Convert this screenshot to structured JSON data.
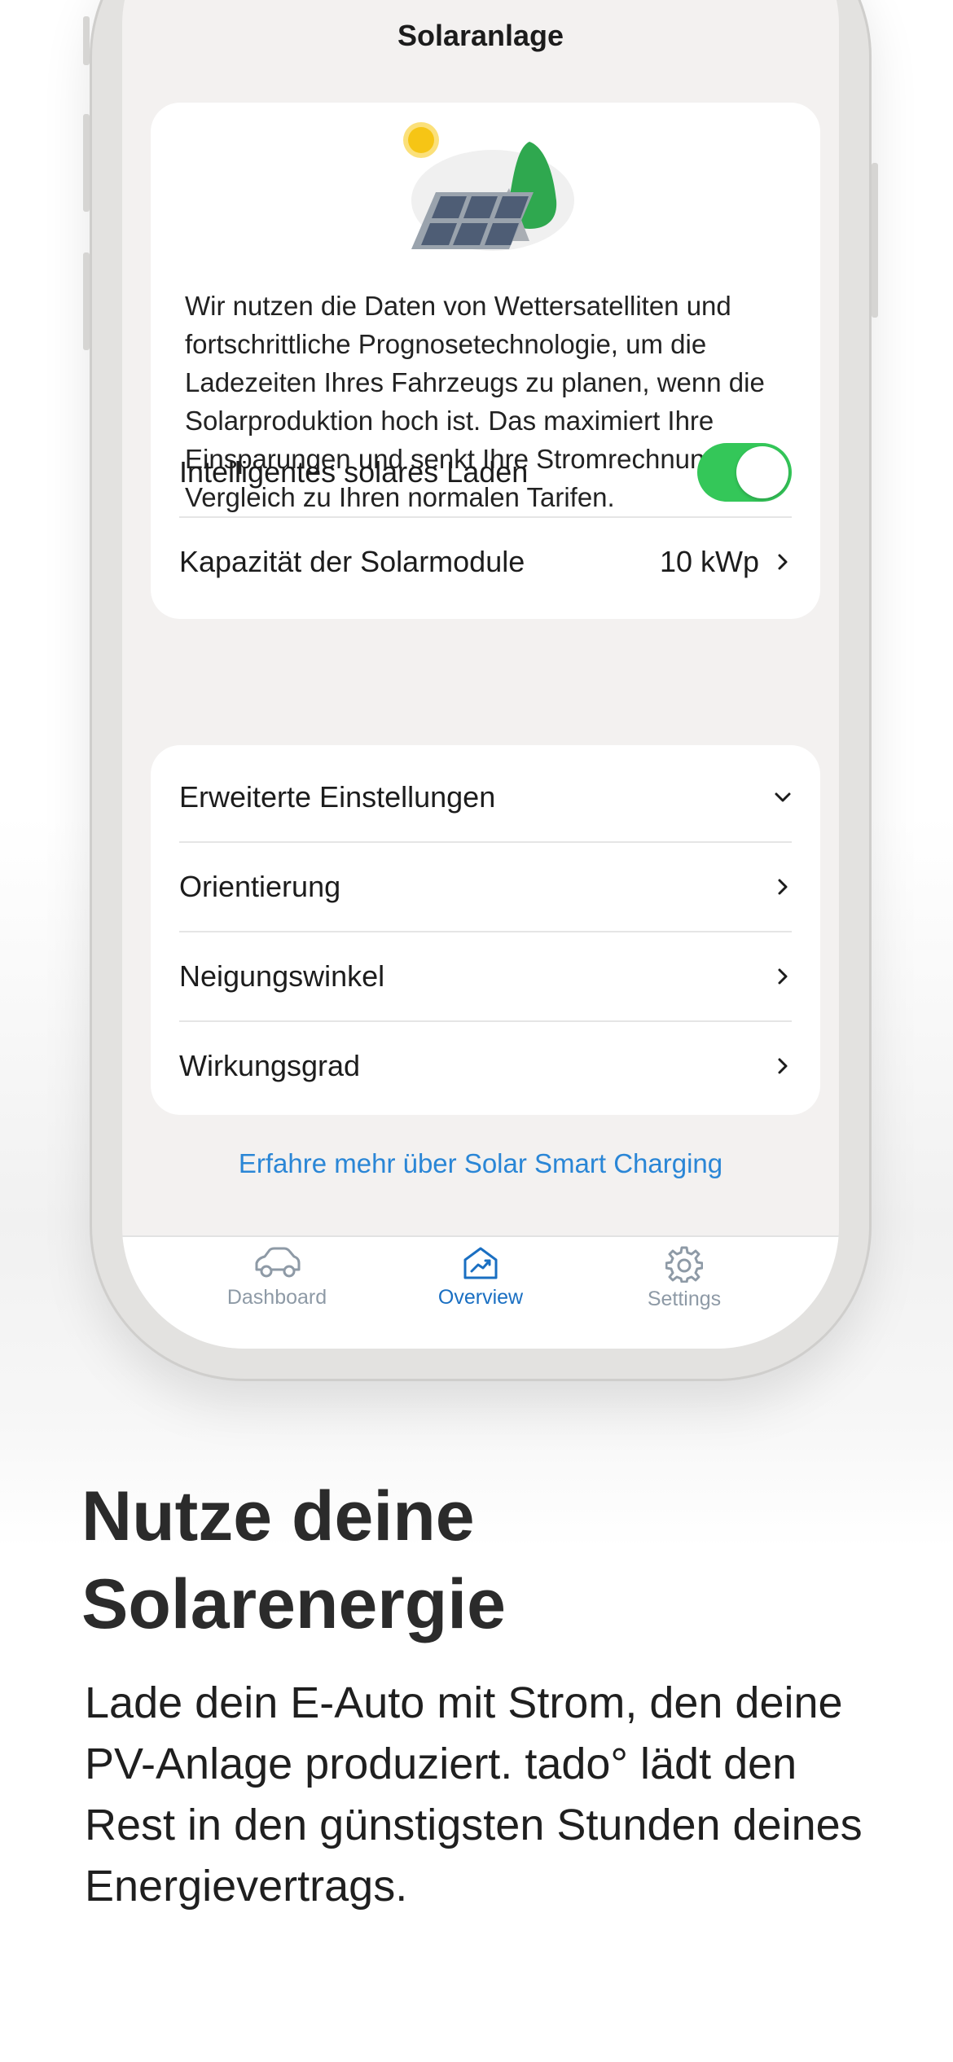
{
  "screen": {
    "title": "Solaranlage",
    "description": "Wir nutzen die Daten von Wettersatelliten und fortschrittliche Prognosetechnologie, um die Ladezeiten Ihres Fahrzeugs zu planen, wenn die Solarproduktion hoch ist. Das maximiert Ihre Einsparungen und senkt Ihre Stromrechnung im Vergleich zu Ihren normalen Tarifen.",
    "smart_charging": {
      "label": "Intelligentes solares Laden",
      "enabled": true
    },
    "capacity": {
      "label": "Kapazität der Solarmodule",
      "value": "10 kWp"
    },
    "advanced": {
      "header": "Erweiterte Einstellungen",
      "items": [
        {
          "label": "Orientierung"
        },
        {
          "label": "Neigungswinkel"
        },
        {
          "label": "Wirkungsgrad"
        }
      ]
    },
    "learn_more": "Erfahre mehr über Solar Smart Charging"
  },
  "tabbar": {
    "tabs": [
      {
        "label": "Dashboard",
        "icon": "car-icon",
        "active": false
      },
      {
        "label": "Overview",
        "icon": "chart-house-icon",
        "active": true
      },
      {
        "label": "Settings",
        "icon": "gear-icon",
        "active": false
      }
    ]
  },
  "marketing": {
    "headline_line1": "Nutze deine",
    "headline_line2": "Solarenergie",
    "subtext": "Lade dein E-Auto mit Strom, den deine PV-Anlage produziert. tado° lädt den Rest in den günstigsten Stunden deines Energievertrags."
  },
  "colors": {
    "toggle_on": "#34c759",
    "link": "#2a86d6",
    "tab_active": "#1a6fc2",
    "tab_inactive": "#8e9aa6"
  }
}
